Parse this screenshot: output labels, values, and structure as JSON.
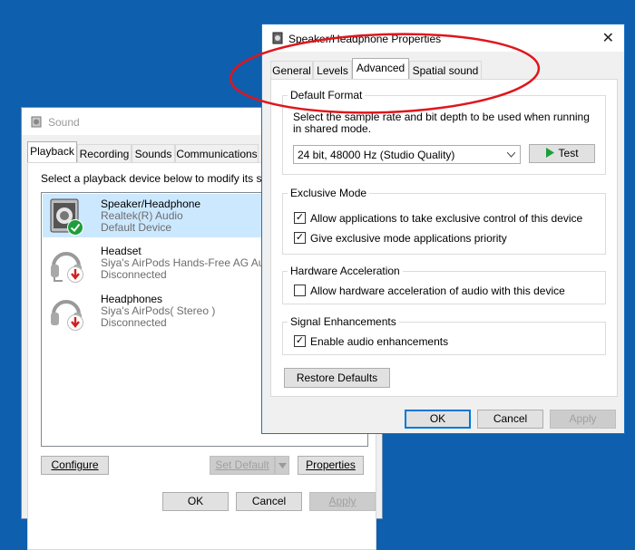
{
  "sound_window": {
    "title": "Sound",
    "tabs": [
      "Playback",
      "Recording",
      "Sounds",
      "Communications"
    ],
    "instruction": "Select a playback device below to modify its sett",
    "devices": [
      {
        "name": "Speaker/Headphone",
        "driver": "Realtek(R) Audio",
        "status": "Default Device"
      },
      {
        "name": "Headset",
        "driver": "Siya's AirPods Hands-Free AG Audi",
        "status": "Disconnected"
      },
      {
        "name": "Headphones",
        "driver": "Siya's AirPods( Stereo )",
        "status": "Disconnected"
      }
    ],
    "configure_label": "Configure",
    "set_default_label": "Set Default",
    "properties_label": "Properties",
    "ok_label": "OK",
    "cancel_label": "Cancel",
    "apply_label": "Apply"
  },
  "props_window": {
    "title": "Speaker/Headphone Properties",
    "close_glyph": "✕",
    "tabs": [
      "General",
      "Levels",
      "Advanced",
      "Spatial sound"
    ],
    "default_format": {
      "label": "Default Format",
      "description_line1": "Select the sample rate and bit depth to be used when running",
      "description_line2": "in shared mode.",
      "selected": "24 bit, 48000 Hz (Studio Quality)",
      "test_label": "Test"
    },
    "exclusive_mode": {
      "label": "Exclusive Mode",
      "option1": "Allow applications to take exclusive control of this device",
      "option2": "Give exclusive mode applications priority"
    },
    "hardware_acceleration": {
      "label": "Hardware Acceleration",
      "option": "Allow hardware acceleration of audio with this device"
    },
    "signal_enhancements": {
      "label": "Signal Enhancements",
      "option": "Enable audio enhancements"
    },
    "restore_label": "Restore Defaults",
    "ok_label": "OK",
    "cancel_label": "Cancel",
    "apply_label": "Apply",
    "check_glyph": "✓"
  },
  "colors": {
    "desktop": "#0e5fad",
    "annotation": "#e0151c",
    "check_green": "#1e9e3a",
    "disconnect_red": "#d32020"
  }
}
